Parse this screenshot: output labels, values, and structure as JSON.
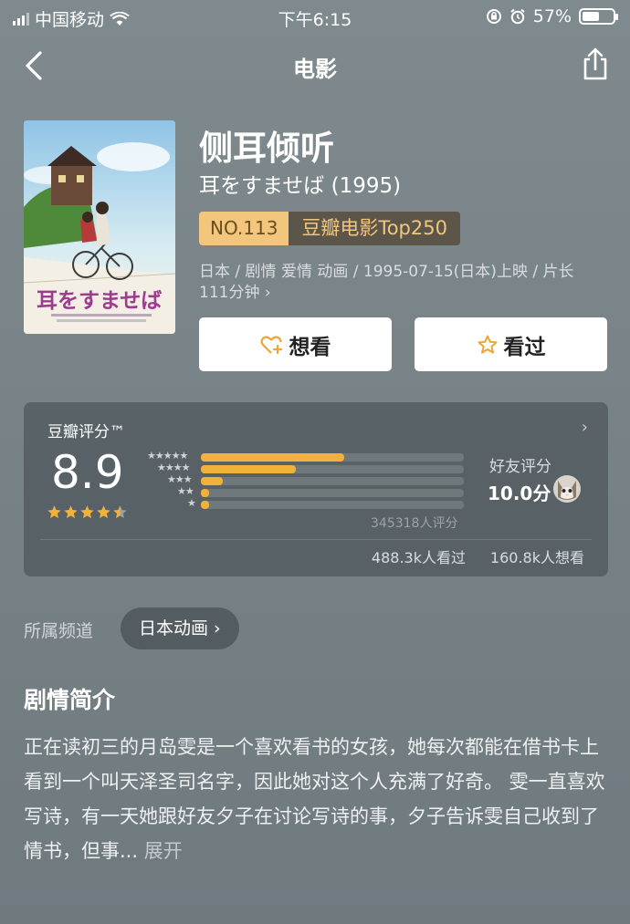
{
  "status_bar": {
    "carrier": "中国移动",
    "time": "下午6:15",
    "battery": "57%",
    "battery_level": 0.57
  },
  "nav": {
    "title": "电影",
    "back_icon": "chevron-left-icon",
    "share_icon": "share-icon"
  },
  "movie": {
    "title": "侧耳倾听",
    "original_title": "耳をすませば (1995)",
    "rank_no": "NO.113",
    "rank_list": "豆瓣电影Top250",
    "meta_line1": "日本 / 剧情 爱情 动画 / 1995-07-15(日本)上映 / 片长",
    "meta_line2": "111分钟 ›",
    "poster_title": "耳をすませば"
  },
  "actions": {
    "want_label": "想看",
    "seen_label": "看过"
  },
  "rating": {
    "label": "豆瓣评分™",
    "score": "8.9",
    "stars_value": 4.5,
    "star_labels": [
      "★★★★★",
      "★★★★",
      "★★★",
      "★★",
      "★"
    ],
    "distribution": [
      0.545,
      0.36,
      0.085,
      0.03,
      0.03
    ],
    "count": "345318人评分",
    "friends_label": "好友评分",
    "friends_score": "10.0分",
    "watched": "488.3k人看过",
    "wanted": "160.8k人想看",
    "bar_color": "#f0b13d"
  },
  "channel": {
    "label": "所属频道",
    "value": "日本动画 ›"
  },
  "synopsis": {
    "title": "剧情简介",
    "text": "正在读初三的月岛雯是一个喜欢看书的女孩，她每次都能在借书卡上看到一个叫天泽圣司名字，因此她对这个人充满了好奇。 雯一直喜欢写诗，有一天她跟好友夕子在讨论写诗的事，夕子告诉雯自己收到了情书，但事...",
    "expand": "展开"
  }
}
